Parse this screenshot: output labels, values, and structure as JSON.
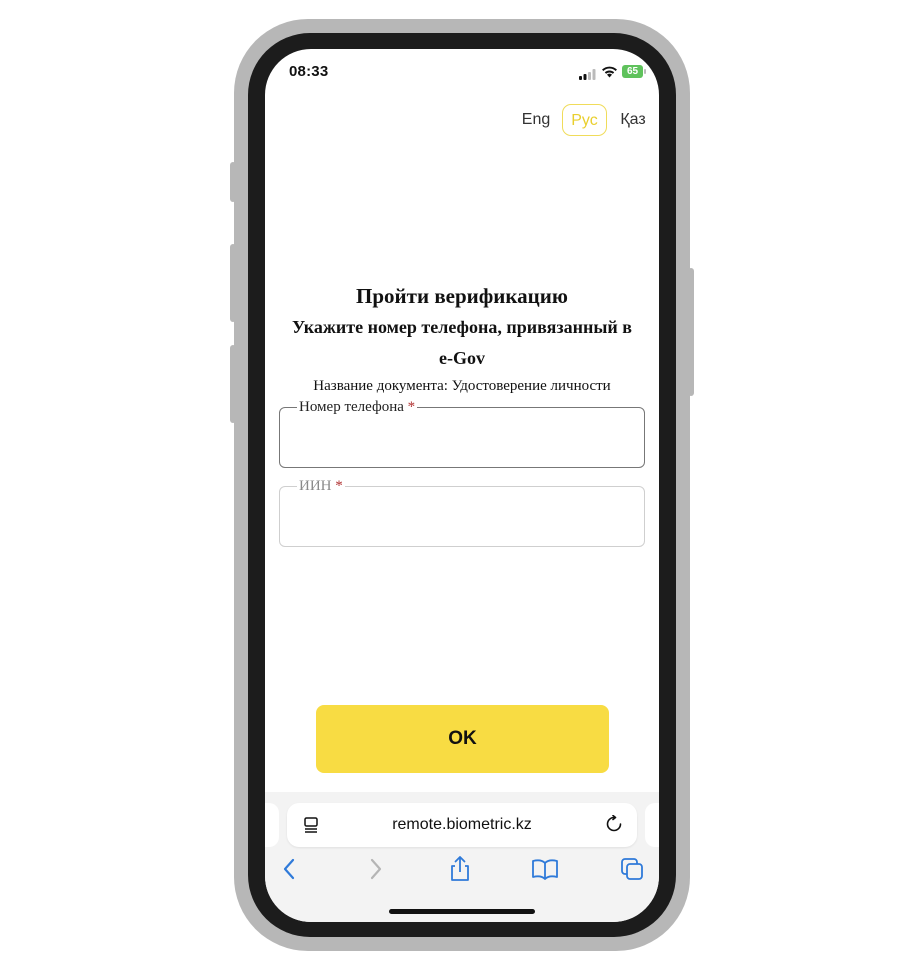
{
  "status_bar": {
    "time": "08:33",
    "battery": "65"
  },
  "language_switcher": {
    "items": [
      "Eng",
      "Рус",
      "Қаз"
    ],
    "active": "Рус"
  },
  "verification": {
    "title": "Пройти верификацию",
    "subtitle_line1": "Укажите номер телефона, привязанный в",
    "subtitle_line2": "e-Gov",
    "document_name": "Название документа: Удостоверение личности"
  },
  "form": {
    "phone": {
      "label": "Номер телефона",
      "required_mark": "*",
      "value": ""
    },
    "iin": {
      "label": "ИИН",
      "required_mark": "*",
      "value": ""
    }
  },
  "ok_button": {
    "label": "OK"
  },
  "browser": {
    "url": "remote.biometric.kz",
    "toolbar_icons": [
      "back-icon",
      "forward-icon",
      "share-icon",
      "bookmarks-icon",
      "tabs-icon"
    ]
  },
  "colors": {
    "accent_yellow": "#f8dc43",
    "active_lang": "#e9cf2e",
    "required": "#b03030"
  }
}
